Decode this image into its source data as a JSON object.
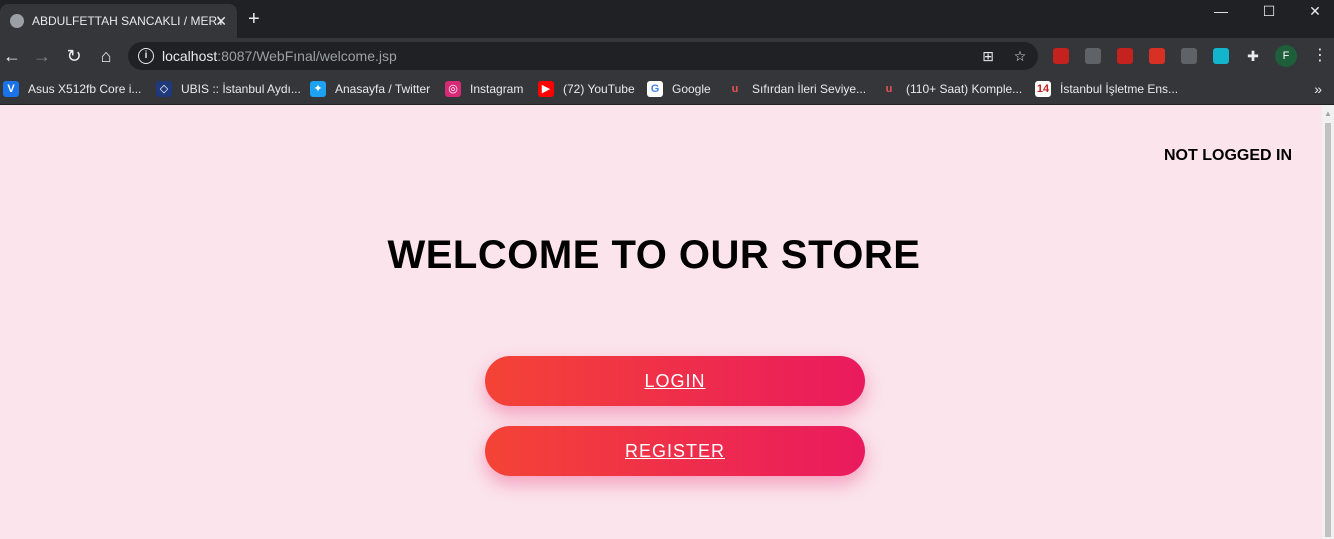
{
  "browser": {
    "tab": {
      "title": "ABDULFETTAH SANCAKLI / MERYEM"
    },
    "url": {
      "host": "localhost",
      "rest": ":8087/WebFınal/welcome.jsp"
    },
    "profile_initial": "F",
    "bookmarks": [
      {
        "label": "Asus X512fb Core i...",
        "icon": "v-icon",
        "color": "#1a73e8"
      },
      {
        "label": "UBIS :: İstanbul Aydı...",
        "icon": "ubis-icon",
        "color": "#1f3a7a"
      },
      {
        "label": "Anasayfa / Twitter",
        "icon": "twitter-icon",
        "color": "#1da1f2"
      },
      {
        "label": "Instagram",
        "icon": "instagram-icon",
        "color": "#d62976"
      },
      {
        "label": "(72) YouTube",
        "icon": "youtube-icon",
        "color": "#ff0000"
      },
      {
        "label": "Google",
        "icon": "google-icon",
        "color": "#ffffff"
      },
      {
        "label": "Sıfırdan İleri Seviye...",
        "icon": "udemy-icon",
        "color": "#ec5252"
      },
      {
        "label": "(110+ Saat) Komple...",
        "icon": "udemy-icon",
        "color": "#ec5252"
      },
      {
        "label": "İstanbul İşletme Ens...",
        "icon": "calendar-icon",
        "color": "#ffffff"
      }
    ],
    "extension_colors": [
      "#c5221f",
      "#5f6368",
      "#c5221f",
      "#d93025",
      "#5f6368",
      "#12b5cb"
    ]
  },
  "page": {
    "status": "NOT LOGGED IN",
    "heading": "WELCOME TO OUR STORE",
    "login_label": "LOGIN",
    "register_label": "REGISTER",
    "colors": {
      "background": "#fbe4ec",
      "button_start": "#f44336",
      "button_end": "#ea1a5e"
    }
  }
}
